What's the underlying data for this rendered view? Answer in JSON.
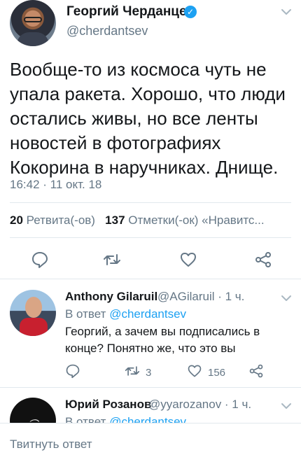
{
  "tweet": {
    "author_name": "Георгий Черданцев",
    "author_handle": "@cherdantsev",
    "text": "Вообще-то из космоса чуть не упала ракета. Хорошо, что люди остались живы, но все ленты новостей в фотографиях Кокорина в наручниках. Днище.",
    "time": "16:42 · 11 окт. 18",
    "retweets_count": "20",
    "retweets_label": "Ретвита(-ов)",
    "likes_count": "137",
    "likes_label": "Отметки(-ок) «Нравитс..."
  },
  "replies": [
    {
      "author_name": "Anthony Gilaruil",
      "author_handle_time": "@AGilaruil · 1 ч.",
      "reply_to_prefix": "В ответ",
      "reply_to_handle": "@cherdantsev",
      "text": "Георгий, а зачем вы подписались в конце? Понятно же, что это вы",
      "retweets": "3",
      "likes": "156"
    },
    {
      "author_name": "Юрий Розанов",
      "author_handle_time": "@yyarozanov · 1 ч.",
      "reply_to_prefix": "В ответ",
      "reply_to_handle": "@cherdantsev"
    }
  ],
  "compose": {
    "placeholder": "Твитнуть ответ"
  },
  "icons": {
    "verified": "verified-badge-icon",
    "menu": "chevron-down-icon",
    "reply": "reply-icon",
    "retweet": "retweet-icon",
    "like": "heart-icon",
    "share": "share-icon"
  },
  "colors": {
    "accent": "#1da1f2",
    "muted": "#657786",
    "text": "#14171a",
    "divider": "#e1e8ed"
  }
}
